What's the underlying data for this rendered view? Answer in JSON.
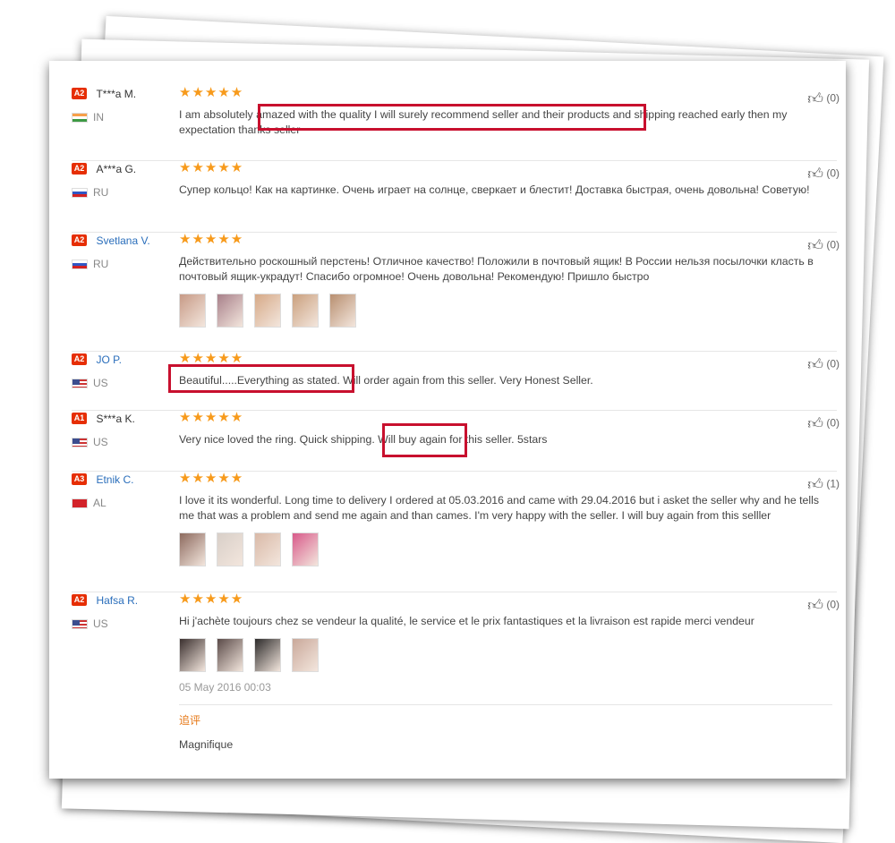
{
  "reviews": [
    {
      "badge": "A2",
      "name": "T***a M.",
      "country": "IN",
      "flag": "in",
      "stars": "★★★★★",
      "text": "I am absolutely amazed with the quality I will surely recommend seller and their products and shipping reached early then my expectation thanks seller",
      "likes": "(0)",
      "photos": []
    },
    {
      "badge": "A2",
      "name": "A***a G.",
      "country": "RU",
      "flag": "ru",
      "stars": "★★★★★",
      "text": "Супер кольцо! Как на картинке. Очень играет на солнце, сверкает и блестит! Доставка быстрая, очень довольна! Советую!",
      "likes": "(0)",
      "photos": []
    },
    {
      "badge": "A2",
      "name": "Svetlana V.",
      "country": "RU",
      "flag": "ru",
      "stars": "★★★★★",
      "text": "Действительно роскошный перстень! Отличное качество! Положили в почтовый ящик! В России нельзя посылочки класть в почтовый ящик-украдут! Спасибо огромное! Очень довольна! Рекомендую! Пришло быстро",
      "likes": "(0)",
      "photos": [
        "#c79a86",
        "#a8808a",
        "#d6a987",
        "#caa07e",
        "#b88f70"
      ]
    },
    {
      "badge": "A2",
      "name": "JO P.",
      "country": "US",
      "flag": "us",
      "stars": "★★★★★",
      "text": "Beautiful.....Everything as stated. Will order again from this seller. Very Honest Seller.",
      "likes": "(0)",
      "photos": []
    },
    {
      "badge": "A1",
      "name": "S***a K.",
      "country": "US",
      "flag": "us",
      "stars": "★★★★★",
      "text": "Very nice loved the ring. Quick shipping. Will buy again for this seller. 5stars",
      "likes": "(0)",
      "photos": []
    },
    {
      "badge": "A3",
      "name": "Etnik C.",
      "country": "AL",
      "flag": "al",
      "stars": "★★★★★",
      "text": "I love it its wonderful. Long time to delivery I ordered at 05.03.2016 and came with 29.04.2016 but i asket the seller why and he tells me that was a problem and send me again and than cames. I'm very happy with the seller. I will buy again from this selller",
      "likes": "(1)",
      "photos": [
        "#8d6a5e",
        "#d8cfc8",
        "#d9b9a7",
        "#d85a8a"
      ]
    },
    {
      "badge": "A2",
      "name": "Hafsa R.",
      "country": "US",
      "flag": "us",
      "stars": "★★★★★",
      "text": "Hi j'achète toujours chez se vendeur la qualité, le service et le prix fantastiques et la livraison est rapide merci vendeur",
      "likes": "(0)",
      "photos": [
        "#3a2f2e",
        "#5a4a48",
        "#2c2a2a",
        "#c9a89a"
      ],
      "date": "05 May 2016 00:03",
      "additional_label": "追评",
      "additional_text": "Magnifique"
    }
  ],
  "icons": {
    "like": "thumbs-up-icon",
    "flag": "country-flag-icon",
    "star": "star-rating-icon"
  },
  "colors": {
    "highlight": "#c8102e",
    "stars": "#f79a1b",
    "badge": "#e62e04",
    "link": "#2a6ebb"
  }
}
